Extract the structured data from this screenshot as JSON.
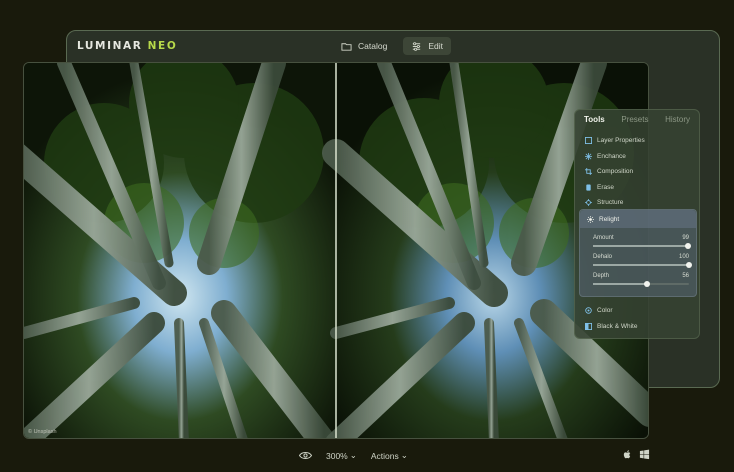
{
  "app": {
    "brand_part1": "LUMINAR",
    "brand_part2": "NEO",
    "brand_color": "#b7d94a"
  },
  "top_tabs": [
    {
      "label": "Catalog",
      "icon": "folder-icon",
      "active": false
    },
    {
      "label": "Edit",
      "icon": "sliders-icon",
      "active": true
    }
  ],
  "canvas": {
    "watermark": "© Unsplash"
  },
  "panel": {
    "tabs": [
      {
        "label": "Tools",
        "active": true
      },
      {
        "label": "Presets",
        "active": false
      },
      {
        "label": "History",
        "active": false
      }
    ],
    "tools": [
      {
        "label": "Layer Properties",
        "icon": "layers-icon"
      },
      {
        "label": "Enchance",
        "icon": "enhance-icon"
      },
      {
        "label": "Composition",
        "icon": "crop-icon"
      },
      {
        "label": "Erase",
        "icon": "erase-icon"
      },
      {
        "label": "Structure",
        "icon": "structure-icon"
      }
    ],
    "relight": {
      "label": "Relight",
      "icon": "sun-icon",
      "sliders": [
        {
          "label": "Amount",
          "value": "99",
          "fraction": 0.99
        },
        {
          "label": "Dehalo",
          "value": "100",
          "fraction": 1.0
        },
        {
          "label": "Depth",
          "value": "56",
          "fraction": 0.56
        }
      ]
    },
    "tools_after": [
      {
        "label": "Color",
        "icon": "color-icon"
      },
      {
        "label": "Black & White",
        "icon": "bw-icon"
      }
    ]
  },
  "bottom_bar": {
    "eye_icon": "eye-icon",
    "zoom": "300%",
    "actions": "Actions"
  },
  "os_icons": [
    "apple-icon",
    "windows-icon"
  ]
}
